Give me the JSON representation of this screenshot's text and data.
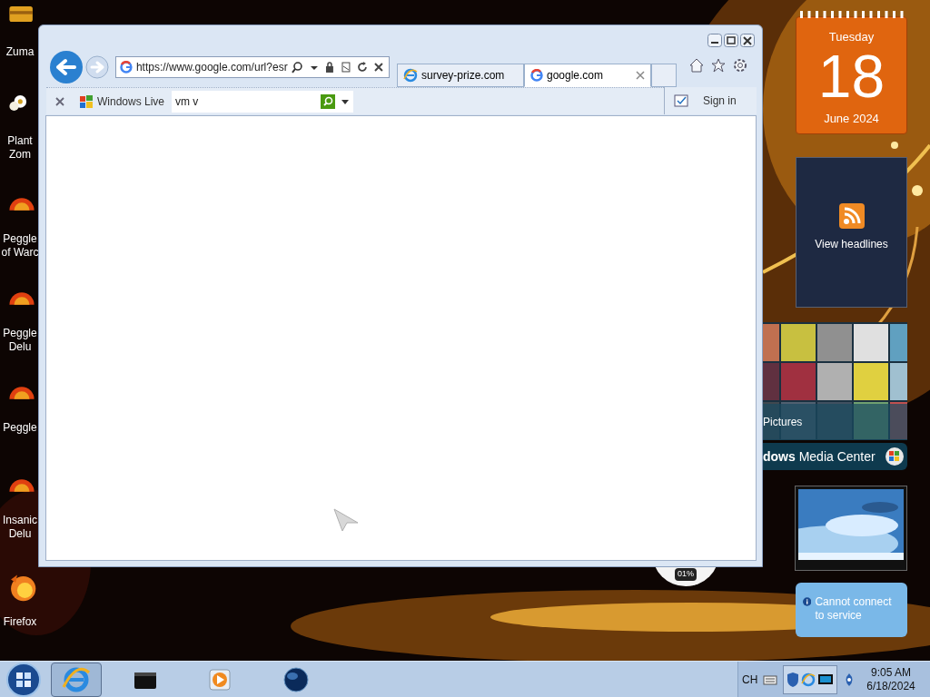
{
  "desktop_icons": [
    {
      "kind": "zuma",
      "lines": [
        "Zuma"
      ]
    },
    {
      "kind": "flower",
      "lines": [
        "Plant",
        "Zom"
      ]
    },
    {
      "kind": "peggle",
      "lines": [
        "Peggle",
        "of Warc"
      ]
    },
    {
      "kind": "peggle",
      "lines": [
        "Peggle",
        "Delu"
      ]
    },
    {
      "kind": "peggle",
      "lines": [
        "Peggle"
      ]
    },
    {
      "kind": "peggle",
      "lines": [
        "Insanic",
        "Delu"
      ]
    },
    {
      "kind": "firefox",
      "lines": [
        "Firefox"
      ]
    }
  ],
  "browser": {
    "address": "https://www.google.com/url?esr",
    "tabs": [
      {
        "label": "survey-prize.com",
        "kind": "ie",
        "selected": false
      },
      {
        "label": "google.com",
        "kind": "google",
        "selected": true
      }
    ],
    "toolbar": {
      "brand": "Windows Live",
      "search_value": "vm v",
      "sign_in": "Sign in"
    }
  },
  "gadgets": {
    "calendar": {
      "weekday": "Tuesday",
      "day": "18",
      "month_year": "June 2024"
    },
    "feed": {
      "label": "View headlines"
    },
    "media_center": {
      "section": "Pictures",
      "brand": "**dows** Media Center"
    },
    "weather": {
      "message": "Cannot connect to service"
    },
    "cpu_meter": {
      "reading": "01%"
    }
  },
  "taskbar": {
    "items": [
      {
        "kind": "ie",
        "selected": true
      },
      {
        "kind": "box",
        "selected": false
      },
      {
        "kind": "player",
        "selected": false
      },
      {
        "kind": "globe",
        "selected": false
      }
    ],
    "language": "CH",
    "time": "9:05 AM",
    "date": "6/18/2024"
  }
}
